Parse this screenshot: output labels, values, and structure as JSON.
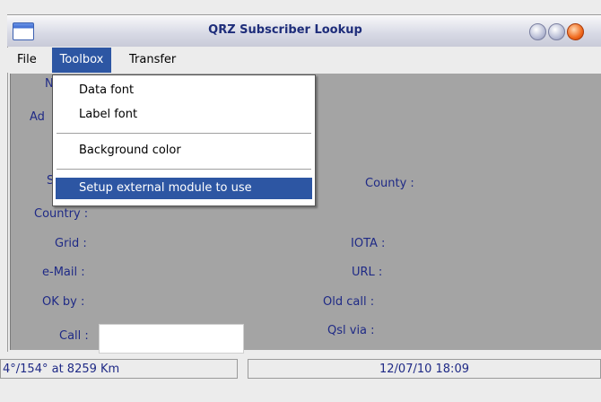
{
  "window": {
    "title": "QRZ Subscriber Lookup"
  },
  "menubar": {
    "file": "File",
    "toolbox": "Toolbox",
    "transfer": "Transfer"
  },
  "toolbox_menu": {
    "data_font": "Data font",
    "label_font": "Label font",
    "background_color": "Background color",
    "setup_external": "Setup external module to use"
  },
  "form": {
    "partial_n": "N",
    "partial_ad": "Ad",
    "partial_s": "S",
    "country": "Country :",
    "grid": "Grid :",
    "email": "e-Mail :",
    "ok_by": "OK by :",
    "call": "Call :",
    "county": "County :",
    "iota": "IOTA :",
    "url": "URL :",
    "old_call": "Old call :",
    "qsl_via": "Qsl via :",
    "call_value": ""
  },
  "status": {
    "bearing": "4°/154° at  8259 Km",
    "datetime": "12/07/10  18:09"
  },
  "colors": {
    "menu_highlight": "#2d56a3",
    "label_text": "#1f2a86",
    "form_bg": "#a4a4a4"
  }
}
